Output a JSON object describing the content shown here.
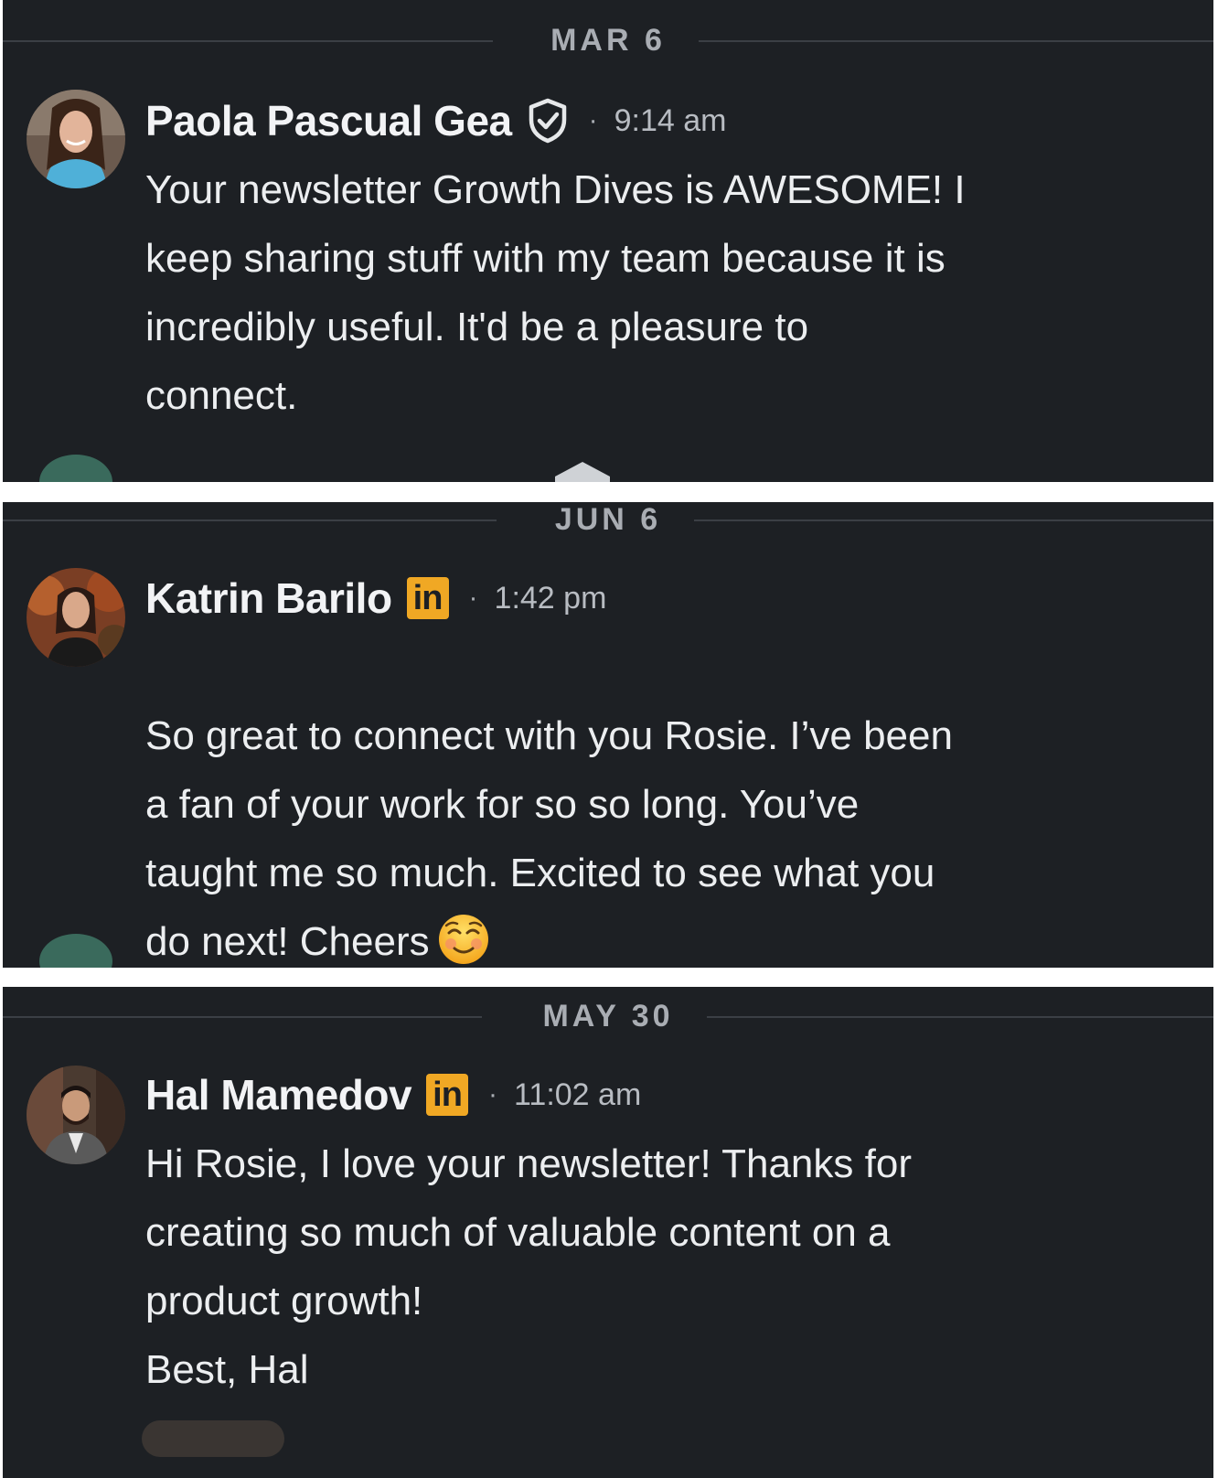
{
  "threads": [
    {
      "date": "MAR 6",
      "sender": "Paola Pascual Gea",
      "badge": "verified-shield-icon",
      "separator": "·",
      "time": "9:14 am",
      "message": "Your newsletter Growth Dives is AWESOME! I\nkeep sharing stuff with my team because it is\nincredibly useful. It'd be a pleasure to\nconnect."
    },
    {
      "date": "JUN 6",
      "sender": "Katrin Barilo",
      "badge": "linkedin-icon",
      "badge_text": "in",
      "separator": "·",
      "time": "1:42 pm",
      "message": "So great to connect with you Rosie. I’ve been\na fan of your work for so so long. You’ve\ntaught me so much. Excited to see what you\ndo next! Cheers",
      "emoji": "smiling-face-emoji"
    },
    {
      "date": "MAY 30",
      "sender": "Hal Mamedov",
      "badge": "linkedin-icon",
      "badge_text": "in",
      "separator": "·",
      "time": "11:02 am",
      "message": "Hi Rosie, I love your newsletter! Thanks for\ncreating so much of valuable content on a\nproduct growth!\nBest, Hal"
    }
  ],
  "colors": {
    "background": "#1d2024",
    "text": "#eceef0",
    "muted": "#a9adb3",
    "linkedin_badge": "#f0a824"
  }
}
